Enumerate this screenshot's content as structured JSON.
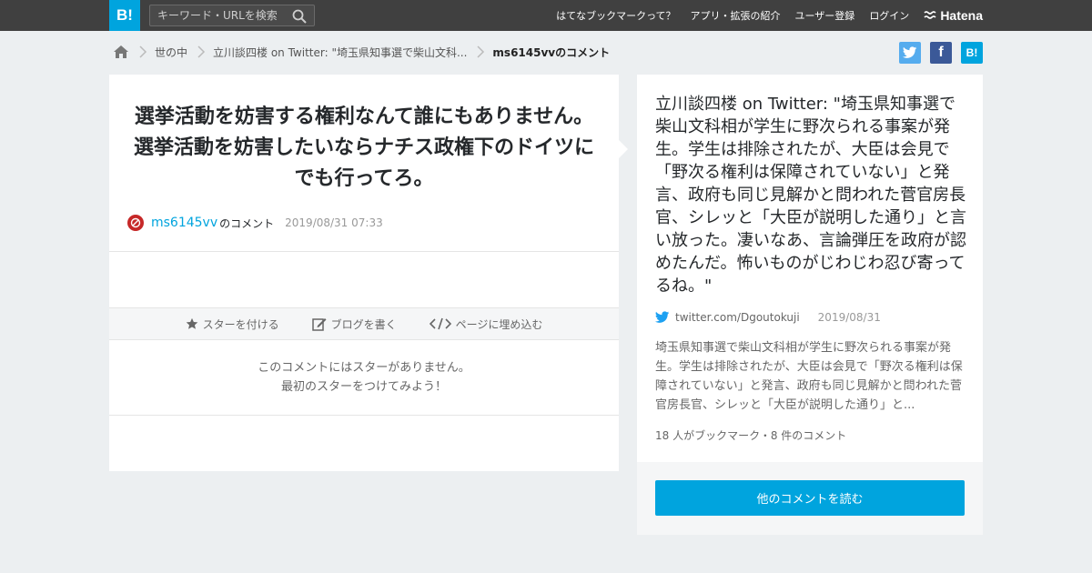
{
  "header": {
    "logo": "B!",
    "search_placeholder": "キーワード・URLを検索",
    "nav": [
      "はてなブックマークって？",
      "アプリ・拡張の紹介",
      "ユーザー登録",
      "ログイン"
    ],
    "brand": "Hatena"
  },
  "breadcrumb": {
    "category": "世の中",
    "entry": "立川談四楼 on Twitter: \"埼玉県知事選で柴山文科...",
    "current": "ms6145vvのコメント"
  },
  "share": {
    "facebook": "f",
    "hatena": "B!"
  },
  "comment": {
    "text": "選挙活動を妨害する権利なんて誰にもありません。選挙活動を妨害したいならナチス政権下のドイツにでも行ってろ。",
    "user": "ms6145vv",
    "user_suffix": "のコメント",
    "date": "2019/08/31 07:33"
  },
  "actions": {
    "star": "スターを付ける",
    "blog": "ブログを書く",
    "embed": "ページに埋め込む"
  },
  "no_star": {
    "line1": "このコメントにはスターがありません。",
    "line2": "最初のスターをつけてみよう！"
  },
  "entry": {
    "title": "立川談四楼 on Twitter: \"埼玉県知事選で柴山文科相が学生に野次られる事案が発生。学生は排除されたが、大臣は会見で「野次る権利は保障されていない」と発言、政府も同じ見解かと問われた菅官房長官、シレッと「大臣が説明した通り」と言い放った。凄いなあ、言論弾圧を政府が認めたんだ。怖いものがじわじわ忍び寄ってるね。\"",
    "source": "twitter.com/Dgoutokuji",
    "date": "2019/08/31",
    "summary": "埼玉県知事選で柴山文科相が学生に野次られる事案が発生。学生は排除されたが、大臣は会見で「野次る権利は保障されていない」と発言、政府も同じ見解かと問われた菅官房長官、シレッと「大臣が説明した通り」と...",
    "counts": "18 人がブックマーク・8 件のコメント",
    "read_button": "他のコメントを読む"
  },
  "colors": {
    "accent": "#00a4de",
    "topbar": "#404040",
    "background": "#eceff1"
  }
}
